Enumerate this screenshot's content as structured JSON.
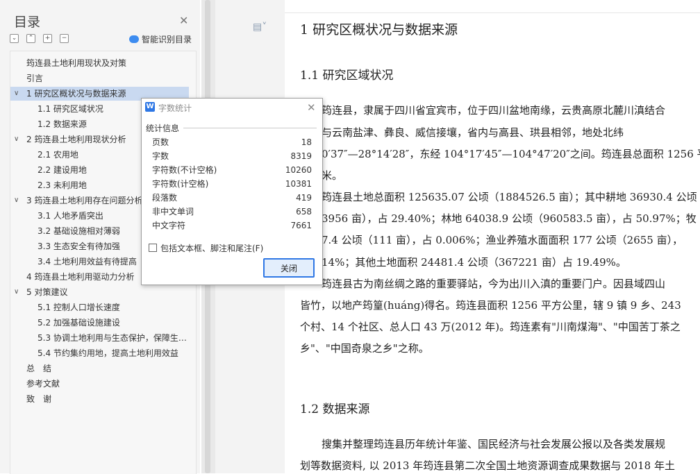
{
  "toc": {
    "title": "目录",
    "smart_label": "智能识别目录",
    "items": [
      {
        "label": "筠连县土地利用现状及对策",
        "level": 0,
        "chev": ""
      },
      {
        "label": "引言",
        "level": 0,
        "chev": ""
      },
      {
        "label": "1 研究区概状况与数据来源",
        "level": 0,
        "chev": "∨",
        "selected": true
      },
      {
        "label": "1.1 研究区域状况",
        "level": 1,
        "chev": ""
      },
      {
        "label": "1.2 数据来源",
        "level": 1,
        "chev": ""
      },
      {
        "label": "2 筠连县土地利用现状分析",
        "level": 0,
        "chev": "∨"
      },
      {
        "label": "2.1 农用地",
        "level": 1,
        "chev": ""
      },
      {
        "label": "2.2 建设用地",
        "level": 1,
        "chev": ""
      },
      {
        "label": "2.3 未利用地",
        "level": 1,
        "chev": ""
      },
      {
        "label": "3 筠连县土地利用存在问题分析",
        "level": 0,
        "chev": "∨"
      },
      {
        "label": "3.1 人地矛盾突出",
        "level": 1,
        "chev": ""
      },
      {
        "label": "3.2 基础设施相对薄弱",
        "level": 1,
        "chev": ""
      },
      {
        "label": "3.3 生态安全有待加强",
        "level": 1,
        "chev": ""
      },
      {
        "label": "3.4 土地利用效益有待提高",
        "level": 1,
        "chev": ""
      },
      {
        "label": "4 筠连县土地利用驱动力分析",
        "level": 0,
        "chev": ""
      },
      {
        "label": "5 对策建议",
        "level": 0,
        "chev": "∨"
      },
      {
        "label": "5.1 控制人口增长速度",
        "level": 1,
        "chev": ""
      },
      {
        "label": "5.2 加强基础设施建设",
        "level": 1,
        "chev": ""
      },
      {
        "label": "5.3 协调土地利用与生态保护，保障生…",
        "level": 1,
        "chev": ""
      },
      {
        "label": "5.4 节约集约用地，提高土地利用效益",
        "level": 1,
        "chev": ""
      },
      {
        "label": "总　结",
        "level": 0,
        "chev": ""
      },
      {
        "label": "参考文献",
        "level": 0,
        "chev": ""
      },
      {
        "label": "致　谢",
        "level": 0,
        "chev": ""
      }
    ]
  },
  "doc": {
    "h1": "1 研究区概状况与数据来源",
    "h1_1": "1.1 研究区域状况",
    "p1": [
      "筠连县，隶属于四川省宜宾市，位于四川盆地南缘，云贵高原北麓川滇结合",
      "与云南盐津、彝良、威信接壤，省内与高县、珙县相邻，地处北纬",
      "0′37″—28°14′28″，东经 104°17′45″—104°47′20″之间。筠连县总面积 1256 平",
      "米。"
    ],
    "p2": [
      "筠连县土地总面积 125635.07 公顷（1884526.5 亩）；其中耕地 36930.4 公顷",
      "3956 亩），占 29.40%；林地 64038.9 公顷（960583.5 亩），占 50.97%；牧",
      "7.4 公顷（111 亩），占 0.006%；渔业养殖水面面积 177 公顷（2655 亩），",
      "14%；其他土地面积 24481.4 公顷（367221 亩）占 19.49%。"
    ],
    "p3": [
      "筠连县古为南丝绸之路的重要驿站，今为出川入滇的重要门户。因县域四山",
      "皆竹，以地产筠篁(huáng)得名。筠连县面积 1256 平方公里，辖 9 镇 9 乡、243",
      "个村、14 个社区、总人口 43 万(2012 年)。筠连素有\"川南煤海\"、\"中国苦丁茶之",
      "乡\"、\"中国奇泉之乡\"之称。"
    ],
    "h1_2": "1.2 数据来源",
    "p4": [
      "搜集并整理筠连县历年统计年鉴、国民经济与社会发展公报以及各类发展规",
      "划等数据资料, 以 2013 年筠连县第二次全国土地资源调查成果数据与 2018 年土"
    ]
  },
  "dialog": {
    "title": "字数统计",
    "section": "统计信息",
    "stats": [
      {
        "label": "页数",
        "value": "18"
      },
      {
        "label": "字数",
        "value": "8319"
      },
      {
        "label": "字符数(不计空格)",
        "value": "10260"
      },
      {
        "label": "字符数(计空格)",
        "value": "10381"
      },
      {
        "label": "段落数",
        "value": "419"
      },
      {
        "label": "非中文单词",
        "value": "658"
      },
      {
        "label": "中文字符",
        "value": "7661"
      }
    ],
    "checkbox_label": "包括文本框、脚注和尾注(F)",
    "checkbox_checked": false,
    "close_label": "关闭"
  }
}
